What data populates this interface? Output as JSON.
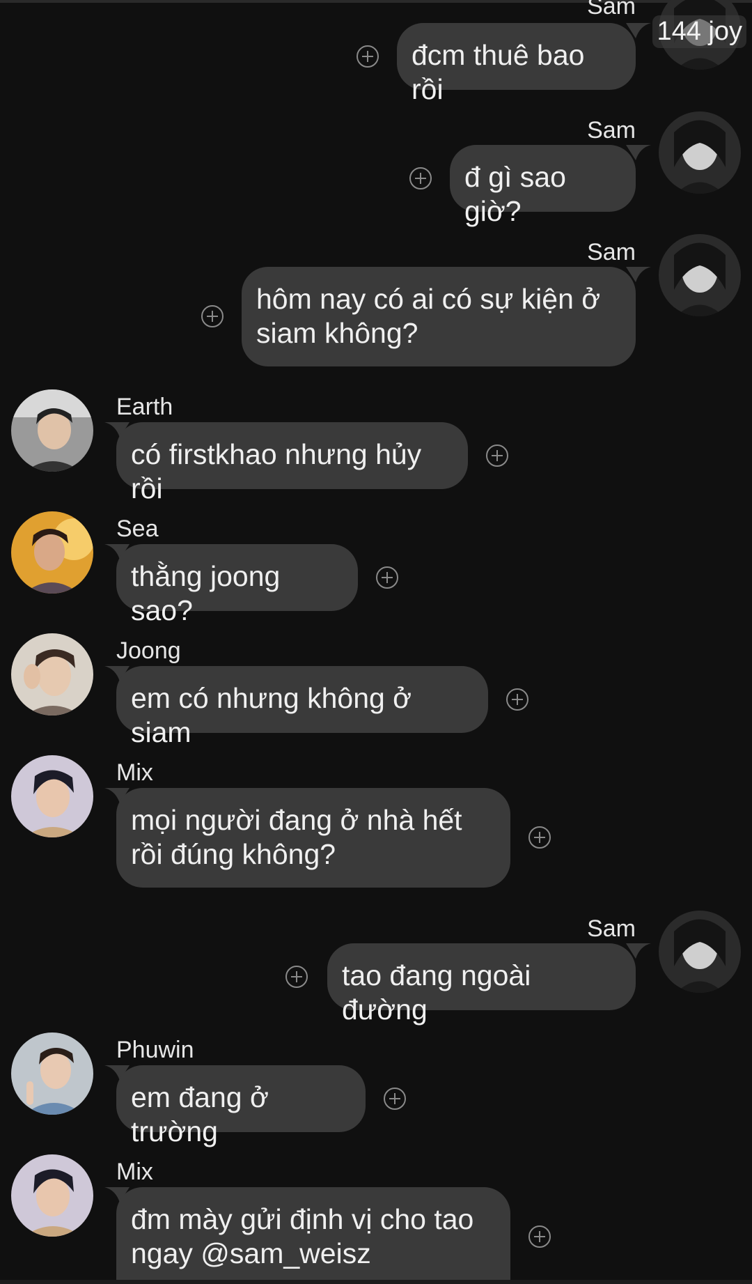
{
  "corner_badge": "144 joy",
  "messages": [
    {
      "sender": "Sam",
      "text": "đcm thuê bao rồi",
      "direction": "out"
    },
    {
      "sender": "Sam",
      "text": "đ gì sao giờ?",
      "direction": "out"
    },
    {
      "sender": "Sam",
      "text": "hôm nay có ai có sự kiện ở siam không?",
      "direction": "out"
    },
    {
      "sender": "Earth",
      "text": "có firstkhao nhưng hủy rồi",
      "direction": "in"
    },
    {
      "sender": "Sea",
      "text": "thằng joong sao?",
      "direction": "in"
    },
    {
      "sender": "Joong",
      "text": "em có nhưng không ở siam",
      "direction": "in"
    },
    {
      "sender": "Mix",
      "text": "mọi người đang ở nhà hết rồi đúng không?",
      "direction": "in"
    },
    {
      "sender": "Sam",
      "text": "tao đang ngoài đường",
      "direction": "out"
    },
    {
      "sender": "Phuwin",
      "text": "em đang ở trường",
      "direction": "in"
    },
    {
      "sender": "Mix",
      "text": "đm mày gửi định vị cho tao ngay @sam_weisz",
      "direction": "in"
    }
  ],
  "icons": {
    "reaction": "add-reaction-icon",
    "avatar": "avatar"
  },
  "colors": {
    "background": "#101010",
    "bubble": "#3a3a3a",
    "text": "#f0f0f0"
  }
}
